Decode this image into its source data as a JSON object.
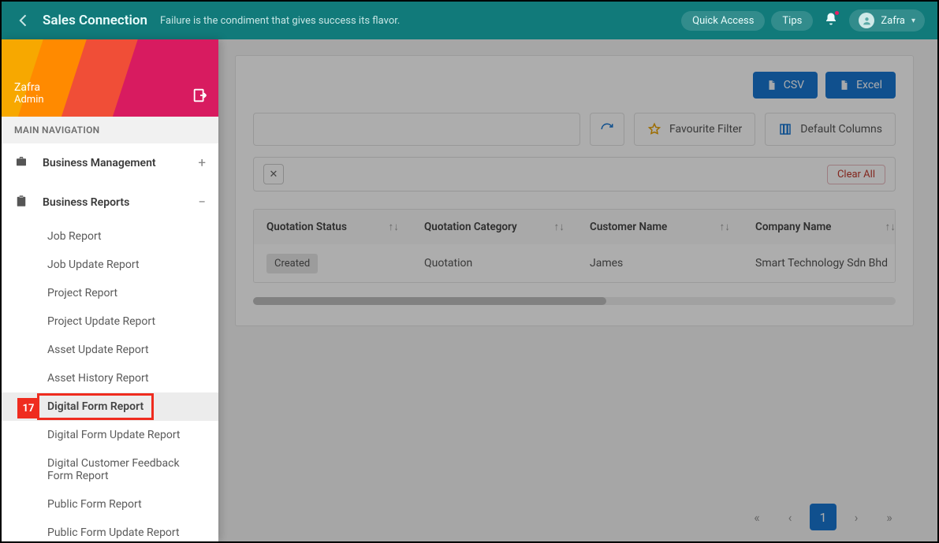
{
  "header": {
    "brand": "Sales Connection",
    "tagline": "Failure is the condiment that gives success its flavor.",
    "quick_access": "Quick Access",
    "tips": "Tips",
    "user_name": "Zafra"
  },
  "sidebar": {
    "user_name": "Zafra",
    "user_role": "Admin",
    "section_label": "MAIN NAVIGATION",
    "items": [
      {
        "label": "Business Management",
        "expander": "+"
      },
      {
        "label": "Business Reports",
        "expander": "−"
      }
    ],
    "reports": [
      "Job Report",
      "Job Update Report",
      "Project Report",
      "Project Update Report",
      "Asset Update Report",
      "Asset History Report",
      "Digital Form Report",
      "Digital Form Update Report",
      "Digital Customer Feedback Form Report",
      "Public Form Report",
      "Public Form Update Report"
    ],
    "step_number": "17"
  },
  "toolbar": {
    "csv": "CSV",
    "excel": "Excel",
    "favourite_filter": "Favourite Filter",
    "default_columns": "Default Columns",
    "clear_all": "Clear All"
  },
  "table": {
    "columns": [
      "Quotation Status",
      "Quotation Category",
      "Customer Name",
      "Company Name"
    ],
    "rows": [
      {
        "status": "Created",
        "category": "Quotation",
        "customer": "James",
        "company": "Smart Technology Sdn Bhd"
      }
    ]
  },
  "pager": {
    "current": "1"
  }
}
